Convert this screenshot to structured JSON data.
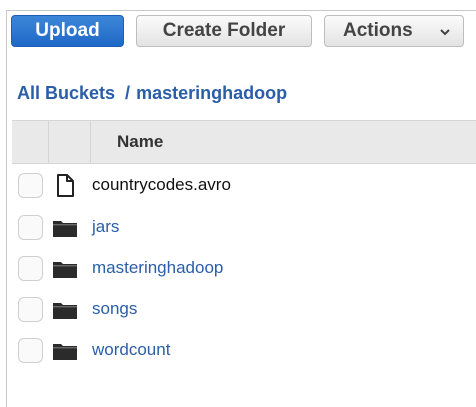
{
  "toolbar": {
    "upload_label": "Upload",
    "create_folder_label": "Create Folder",
    "actions_label": "Actions",
    "actions_icon": "chevron-down-icon"
  },
  "breadcrumb": {
    "root": "All Buckets",
    "separator": "/",
    "current": "masteringhadoop"
  },
  "table": {
    "columns": [
      "Name"
    ],
    "rows": [
      {
        "name": "countrycodes.avro",
        "type": "file",
        "icon": "file-icon"
      },
      {
        "name": "jars",
        "type": "folder",
        "icon": "folder-icon"
      },
      {
        "name": "masteringhadoop",
        "type": "folder",
        "icon": "folder-icon"
      },
      {
        "name": "songs",
        "type": "folder",
        "icon": "folder-icon"
      },
      {
        "name": "wordcount",
        "type": "folder",
        "icon": "folder-icon"
      }
    ]
  },
  "colors": {
    "primary": "#1f69c7",
    "link": "#2a5ea8",
    "header_bg": "#e9e9e9"
  }
}
